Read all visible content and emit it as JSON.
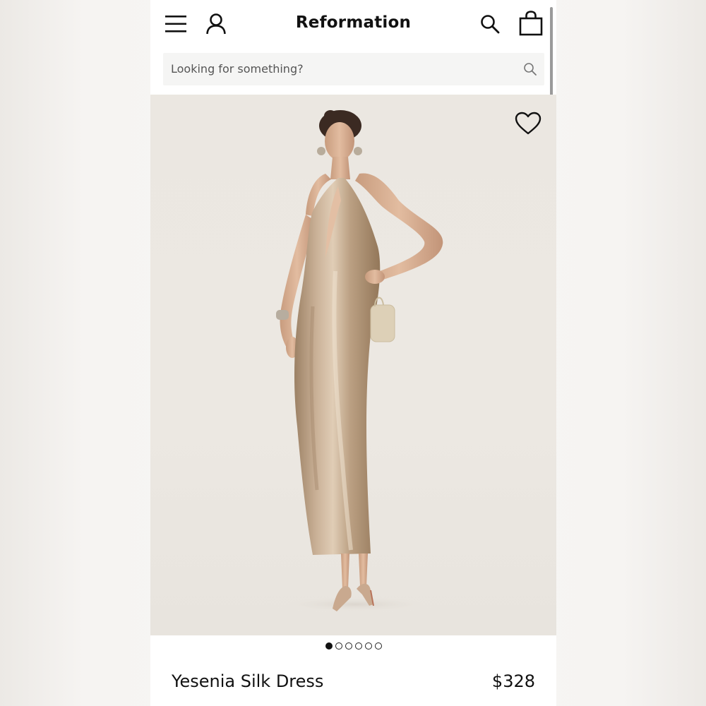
{
  "header": {
    "brand": "Reformation",
    "icons": [
      "menu-icon",
      "account-icon",
      "search-icon",
      "shopping-bag-icon"
    ]
  },
  "search": {
    "placeholder": "Looking for something?"
  },
  "gallery": {
    "image_count": 6,
    "active_index": 0,
    "wishlist_icon": "heart-icon"
  },
  "product": {
    "name": "Yesenia Silk Dress",
    "price": "$328"
  },
  "colors": {
    "background": "#ebe7e1",
    "dress": "#b79c7e",
    "text": "#111111"
  }
}
